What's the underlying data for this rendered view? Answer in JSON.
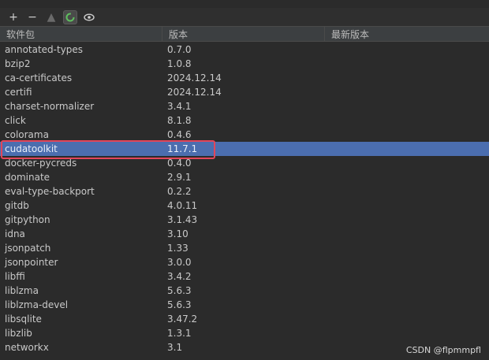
{
  "toolbar": {
    "buttons": [
      {
        "name": "add-icon",
        "glyph": "+"
      },
      {
        "name": "remove-icon",
        "glyph": "−"
      },
      {
        "name": "upgrade-icon",
        "glyph": "▲"
      },
      {
        "name": "refresh-icon",
        "glyph": "◯"
      },
      {
        "name": "eye-icon",
        "glyph": "👁"
      }
    ]
  },
  "table": {
    "headers": [
      "软件包",
      "版本",
      "最新版本"
    ],
    "rows": [
      {
        "name": "annotated-types",
        "version": "0.7.0",
        "latest": ""
      },
      {
        "name": "bzip2",
        "version": "1.0.8",
        "latest": ""
      },
      {
        "name": "ca-certificates",
        "version": "2024.12.14",
        "latest": ""
      },
      {
        "name": "certifi",
        "version": "2024.12.14",
        "latest": ""
      },
      {
        "name": "charset-normalizer",
        "version": "3.4.1",
        "latest": ""
      },
      {
        "name": "click",
        "version": "8.1.8",
        "latest": ""
      },
      {
        "name": "colorama",
        "version": "0.4.6",
        "latest": ""
      },
      {
        "name": "cudatoolkit",
        "version": "11.7.1",
        "latest": "",
        "selected": true
      },
      {
        "name": "docker-pycreds",
        "version": "0.4.0",
        "latest": ""
      },
      {
        "name": "dominate",
        "version": "2.9.1",
        "latest": ""
      },
      {
        "name": "eval-type-backport",
        "version": "0.2.2",
        "latest": ""
      },
      {
        "name": "gitdb",
        "version": "4.0.11",
        "latest": ""
      },
      {
        "name": "gitpython",
        "version": "3.1.43",
        "latest": ""
      },
      {
        "name": "idna",
        "version": "3.10",
        "latest": ""
      },
      {
        "name": "jsonpatch",
        "version": "1.33",
        "latest": ""
      },
      {
        "name": "jsonpointer",
        "version": "3.0.0",
        "latest": ""
      },
      {
        "name": "libffi",
        "version": "3.4.2",
        "latest": ""
      },
      {
        "name": "liblzma",
        "version": "5.6.3",
        "latest": ""
      },
      {
        "name": "liblzma-devel",
        "version": "5.6.3",
        "latest": ""
      },
      {
        "name": "libsqlite",
        "version": "3.47.2",
        "latest": ""
      },
      {
        "name": "libzlib",
        "version": "1.3.1",
        "latest": ""
      },
      {
        "name": "networkx",
        "version": "3.1",
        "latest": ""
      }
    ]
  },
  "watermark": "CSDN @flpmmpfl",
  "colors": {
    "background": "#2b2b2b",
    "selection": "#4b6eaf",
    "highlight_border": "#e2465a"
  }
}
